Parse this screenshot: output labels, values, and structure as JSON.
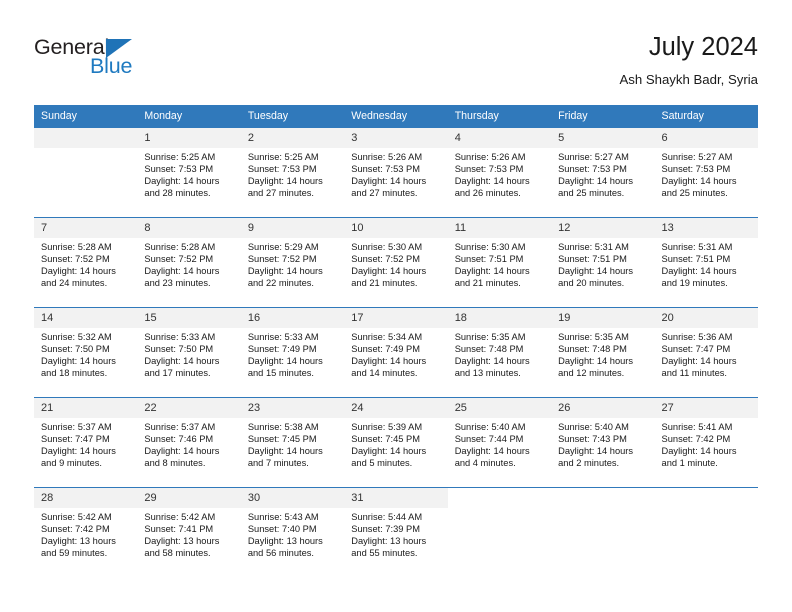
{
  "brand": {
    "name_dark": "General",
    "name_blue": "Blue",
    "accent_color": "#1f7ac0",
    "header_color": "#3079bb"
  },
  "header": {
    "title": "July 2024",
    "subtitle": "Ash Shaykh Badr, Syria"
  },
  "weekday_headers": [
    "Sunday",
    "Monday",
    "Tuesday",
    "Wednesday",
    "Thursday",
    "Friday",
    "Saturday"
  ],
  "labels": {
    "sunrise_prefix": "Sunrise:",
    "sunset_prefix": "Sunset:",
    "daylight_prefix": "Daylight:"
  },
  "weeks": [
    [
      {
        "day": "",
        "blank": true
      },
      {
        "day": "1",
        "sunrise": "Sunrise: 5:25 AM",
        "sunset": "Sunset: 7:53 PM",
        "daylight1": "Daylight: 14 hours",
        "daylight2": "and 28 minutes."
      },
      {
        "day": "2",
        "sunrise": "Sunrise: 5:25 AM",
        "sunset": "Sunset: 7:53 PM",
        "daylight1": "Daylight: 14 hours",
        "daylight2": "and 27 minutes."
      },
      {
        "day": "3",
        "sunrise": "Sunrise: 5:26 AM",
        "sunset": "Sunset: 7:53 PM",
        "daylight1": "Daylight: 14 hours",
        "daylight2": "and 27 minutes."
      },
      {
        "day": "4",
        "sunrise": "Sunrise: 5:26 AM",
        "sunset": "Sunset: 7:53 PM",
        "daylight1": "Daylight: 14 hours",
        "daylight2": "and 26 minutes."
      },
      {
        "day": "5",
        "sunrise": "Sunrise: 5:27 AM",
        "sunset": "Sunset: 7:53 PM",
        "daylight1": "Daylight: 14 hours",
        "daylight2": "and 25 minutes."
      },
      {
        "day": "6",
        "sunrise": "Sunrise: 5:27 AM",
        "sunset": "Sunset: 7:53 PM",
        "daylight1": "Daylight: 14 hours",
        "daylight2": "and 25 minutes."
      }
    ],
    [
      {
        "day": "7",
        "sunrise": "Sunrise: 5:28 AM",
        "sunset": "Sunset: 7:52 PM",
        "daylight1": "Daylight: 14 hours",
        "daylight2": "and 24 minutes."
      },
      {
        "day": "8",
        "sunrise": "Sunrise: 5:28 AM",
        "sunset": "Sunset: 7:52 PM",
        "daylight1": "Daylight: 14 hours",
        "daylight2": "and 23 minutes."
      },
      {
        "day": "9",
        "sunrise": "Sunrise: 5:29 AM",
        "sunset": "Sunset: 7:52 PM",
        "daylight1": "Daylight: 14 hours",
        "daylight2": "and 22 minutes."
      },
      {
        "day": "10",
        "sunrise": "Sunrise: 5:30 AM",
        "sunset": "Sunset: 7:52 PM",
        "daylight1": "Daylight: 14 hours",
        "daylight2": "and 21 minutes."
      },
      {
        "day": "11",
        "sunrise": "Sunrise: 5:30 AM",
        "sunset": "Sunset: 7:51 PM",
        "daylight1": "Daylight: 14 hours",
        "daylight2": "and 21 minutes."
      },
      {
        "day": "12",
        "sunrise": "Sunrise: 5:31 AM",
        "sunset": "Sunset: 7:51 PM",
        "daylight1": "Daylight: 14 hours",
        "daylight2": "and 20 minutes."
      },
      {
        "day": "13",
        "sunrise": "Sunrise: 5:31 AM",
        "sunset": "Sunset: 7:51 PM",
        "daylight1": "Daylight: 14 hours",
        "daylight2": "and 19 minutes."
      }
    ],
    [
      {
        "day": "14",
        "sunrise": "Sunrise: 5:32 AM",
        "sunset": "Sunset: 7:50 PM",
        "daylight1": "Daylight: 14 hours",
        "daylight2": "and 18 minutes."
      },
      {
        "day": "15",
        "sunrise": "Sunrise: 5:33 AM",
        "sunset": "Sunset: 7:50 PM",
        "daylight1": "Daylight: 14 hours",
        "daylight2": "and 17 minutes."
      },
      {
        "day": "16",
        "sunrise": "Sunrise: 5:33 AM",
        "sunset": "Sunset: 7:49 PM",
        "daylight1": "Daylight: 14 hours",
        "daylight2": "and 15 minutes."
      },
      {
        "day": "17",
        "sunrise": "Sunrise: 5:34 AM",
        "sunset": "Sunset: 7:49 PM",
        "daylight1": "Daylight: 14 hours",
        "daylight2": "and 14 minutes."
      },
      {
        "day": "18",
        "sunrise": "Sunrise: 5:35 AM",
        "sunset": "Sunset: 7:48 PM",
        "daylight1": "Daylight: 14 hours",
        "daylight2": "and 13 minutes."
      },
      {
        "day": "19",
        "sunrise": "Sunrise: 5:35 AM",
        "sunset": "Sunset: 7:48 PM",
        "daylight1": "Daylight: 14 hours",
        "daylight2": "and 12 minutes."
      },
      {
        "day": "20",
        "sunrise": "Sunrise: 5:36 AM",
        "sunset": "Sunset: 7:47 PM",
        "daylight1": "Daylight: 14 hours",
        "daylight2": "and 11 minutes."
      }
    ],
    [
      {
        "day": "21",
        "sunrise": "Sunrise: 5:37 AM",
        "sunset": "Sunset: 7:47 PM",
        "daylight1": "Daylight: 14 hours",
        "daylight2": "and 9 minutes."
      },
      {
        "day": "22",
        "sunrise": "Sunrise: 5:37 AM",
        "sunset": "Sunset: 7:46 PM",
        "daylight1": "Daylight: 14 hours",
        "daylight2": "and 8 minutes."
      },
      {
        "day": "23",
        "sunrise": "Sunrise: 5:38 AM",
        "sunset": "Sunset: 7:45 PM",
        "daylight1": "Daylight: 14 hours",
        "daylight2": "and 7 minutes."
      },
      {
        "day": "24",
        "sunrise": "Sunrise: 5:39 AM",
        "sunset": "Sunset: 7:45 PM",
        "daylight1": "Daylight: 14 hours",
        "daylight2": "and 5 minutes."
      },
      {
        "day": "25",
        "sunrise": "Sunrise: 5:40 AM",
        "sunset": "Sunset: 7:44 PM",
        "daylight1": "Daylight: 14 hours",
        "daylight2": "and 4 minutes."
      },
      {
        "day": "26",
        "sunrise": "Sunrise: 5:40 AM",
        "sunset": "Sunset: 7:43 PM",
        "daylight1": "Daylight: 14 hours",
        "daylight2": "and 2 minutes."
      },
      {
        "day": "27",
        "sunrise": "Sunrise: 5:41 AM",
        "sunset": "Sunset: 7:42 PM",
        "daylight1": "Daylight: 14 hours",
        "daylight2": "and 1 minute."
      }
    ],
    [
      {
        "day": "28",
        "sunrise": "Sunrise: 5:42 AM",
        "sunset": "Sunset: 7:42 PM",
        "daylight1": "Daylight: 13 hours",
        "daylight2": "and 59 minutes."
      },
      {
        "day": "29",
        "sunrise": "Sunrise: 5:42 AM",
        "sunset": "Sunset: 7:41 PM",
        "daylight1": "Daylight: 13 hours",
        "daylight2": "and 58 minutes."
      },
      {
        "day": "30",
        "sunrise": "Sunrise: 5:43 AM",
        "sunset": "Sunset: 7:40 PM",
        "daylight1": "Daylight: 13 hours",
        "daylight2": "and 56 minutes."
      },
      {
        "day": "31",
        "sunrise": "Sunrise: 5:44 AM",
        "sunset": "Sunset: 7:39 PM",
        "daylight1": "Daylight: 13 hours",
        "daylight2": "and 55 minutes."
      },
      {
        "day": "",
        "empty": true
      },
      {
        "day": "",
        "empty": true
      },
      {
        "day": "",
        "empty": true
      }
    ]
  ]
}
